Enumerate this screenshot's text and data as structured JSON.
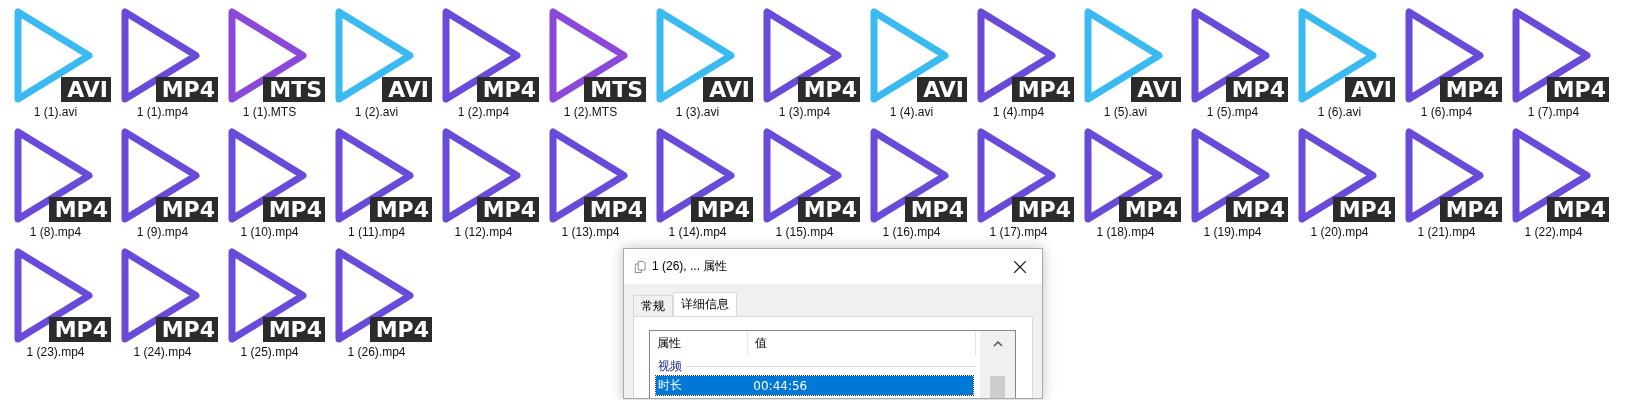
{
  "files": [
    {
      "name": "1 (1).avi",
      "format": "AVI",
      "color": "#3bb9f1"
    },
    {
      "name": "1 (1).mp4",
      "format": "MP4",
      "color": "#6a4bd9"
    },
    {
      "name": "1 (1).MTS",
      "format": "MTS",
      "color": "#8a49d9"
    },
    {
      "name": "1 (2).avi",
      "format": "AVI",
      "color": "#3bb9f1"
    },
    {
      "name": "1 (2).mp4",
      "format": "MP4",
      "color": "#6a4bd9"
    },
    {
      "name": "1 (2).MTS",
      "format": "MTS",
      "color": "#8a49d9"
    },
    {
      "name": "1 (3).avi",
      "format": "AVI",
      "color": "#3bb9f1"
    },
    {
      "name": "1 (3).mp4",
      "format": "MP4",
      "color": "#6a4bd9"
    },
    {
      "name": "1 (4).avi",
      "format": "AVI",
      "color": "#3bb9f1"
    },
    {
      "name": "1 (4).mp4",
      "format": "MP4",
      "color": "#6a4bd9"
    },
    {
      "name": "1 (5).avi",
      "format": "AVI",
      "color": "#3bb9f1"
    },
    {
      "name": "1 (5).mp4",
      "format": "MP4",
      "color": "#6a4bd9"
    },
    {
      "name": "1 (6).avi",
      "format": "AVI",
      "color": "#3bb9f1"
    },
    {
      "name": "1 (6).mp4",
      "format": "MP4",
      "color": "#6a4bd9"
    },
    {
      "name": "1 (7).mp4",
      "format": "MP4",
      "color": "#6a4bd9"
    },
    {
      "name": "1 (8).mp4",
      "format": "MP4",
      "color": "#6a4bd9"
    },
    {
      "name": "1 (9).mp4",
      "format": "MP4",
      "color": "#6a4bd9"
    },
    {
      "name": "1 (10).mp4",
      "format": "MP4",
      "color": "#6a4bd9"
    },
    {
      "name": "1 (11).mp4",
      "format": "MP4",
      "color": "#6a4bd9"
    },
    {
      "name": "1 (12).mp4",
      "format": "MP4",
      "color": "#6a4bd9"
    },
    {
      "name": "1 (13).mp4",
      "format": "MP4",
      "color": "#6a4bd9"
    },
    {
      "name": "1 (14).mp4",
      "format": "MP4",
      "color": "#6a4bd9"
    },
    {
      "name": "1 (15).mp4",
      "format": "MP4",
      "color": "#6a4bd9"
    },
    {
      "name": "1 (16).mp4",
      "format": "MP4",
      "color": "#6a4bd9"
    },
    {
      "name": "1 (17).mp4",
      "format": "MP4",
      "color": "#6a4bd9"
    },
    {
      "name": "1 (18).mp4",
      "format": "MP4",
      "color": "#6a4bd9"
    },
    {
      "name": "1 (19).mp4",
      "format": "MP4",
      "color": "#6a4bd9"
    },
    {
      "name": "1 (20).mp4",
      "format": "MP4",
      "color": "#6a4bd9"
    },
    {
      "name": "1 (21).mp4",
      "format": "MP4",
      "color": "#6a4bd9"
    },
    {
      "name": "1 (22).mp4",
      "format": "MP4",
      "color": "#6a4bd9"
    },
    {
      "name": "1 (23).mp4",
      "format": "MP4",
      "color": "#6a4bd9"
    },
    {
      "name": "1 (24).mp4",
      "format": "MP4",
      "color": "#6a4bd9"
    },
    {
      "name": "1 (25).mp4",
      "format": "MP4",
      "color": "#6a4bd9"
    },
    {
      "name": "1 (26).mp4",
      "format": "MP4",
      "color": "#6a4bd9"
    }
  ],
  "dialog": {
    "title": "1 (26), ... 属性",
    "tabs": [
      {
        "label": "常规",
        "selected": false
      },
      {
        "label": "详细信息",
        "selected": true
      }
    ],
    "columns": [
      "属性",
      "值"
    ],
    "group": "视频",
    "rows": [
      {
        "property": "时长",
        "value": "00:44:56",
        "selected": true
      }
    ]
  }
}
